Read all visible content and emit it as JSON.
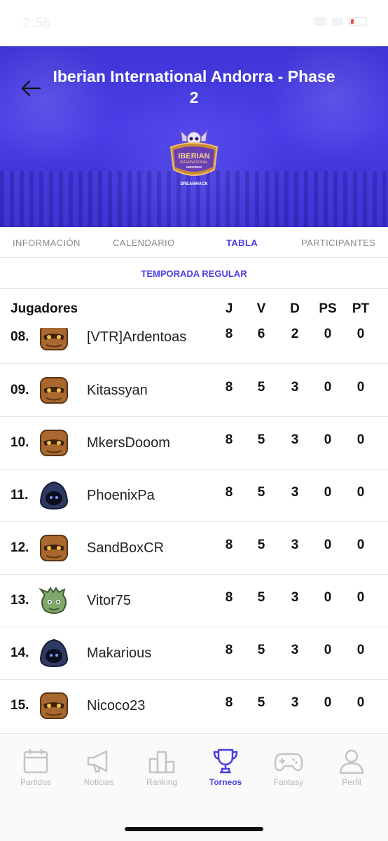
{
  "status_bar": {
    "time": "2:56"
  },
  "header": {
    "title": "Iberian International Andorra - Phase 2",
    "back_icon": "arrow-left-icon"
  },
  "logo": {
    "line1": "IBERIAN",
    "line2": "INTERNATIONAL",
    "line3": "ANDORRA",
    "line4": "DREAMHACK"
  },
  "tabs": [
    {
      "label": "INFORMACIÓN",
      "active": false
    },
    {
      "label": "CALENDARIO",
      "active": false
    },
    {
      "label": "TABLA",
      "active": true
    },
    {
      "label": "PARTICIPANTES",
      "active": false
    }
  ],
  "subtab": {
    "label": "TEMPORADA REGULAR"
  },
  "table": {
    "columns": [
      "Jugadores",
      "J",
      "V",
      "D",
      "PS",
      "PT"
    ],
    "rows": [
      {
        "pos": "08.",
        "name": "[VTR]Ardentoas",
        "avatar": "wood-mask-avatar-icon",
        "j": "8",
        "v": "6",
        "d": "2",
        "ps": "0",
        "pt": "0"
      },
      {
        "pos": "09.",
        "name": "Kitassyan",
        "avatar": "wood-mask-avatar-icon",
        "j": "8",
        "v": "5",
        "d": "3",
        "ps": "0",
        "pt": "0"
      },
      {
        "pos": "10.",
        "name": "MkersDooom",
        "avatar": "wood-mask-avatar-icon",
        "j": "8",
        "v": "5",
        "d": "3",
        "ps": "0",
        "pt": "0"
      },
      {
        "pos": "11.",
        "name": "PhoenixPa",
        "avatar": "hooded-avatar-icon",
        "j": "8",
        "v": "5",
        "d": "3",
        "ps": "0",
        "pt": "0"
      },
      {
        "pos": "12.",
        "name": "SandBoxCR",
        "avatar": "wood-mask-avatar-icon",
        "j": "8",
        "v": "5",
        "d": "3",
        "ps": "0",
        "pt": "0"
      },
      {
        "pos": "13.",
        "name": "Vitor75",
        "avatar": "goblin-avatar-icon",
        "j": "8",
        "v": "5",
        "d": "3",
        "ps": "0",
        "pt": "0"
      },
      {
        "pos": "14.",
        "name": "Makarious",
        "avatar": "hooded-avatar-icon",
        "j": "8",
        "v": "5",
        "d": "3",
        "ps": "0",
        "pt": "0"
      },
      {
        "pos": "15.",
        "name": "Nicoco23",
        "avatar": "wood-mask-avatar-icon",
        "j": "8",
        "v": "5",
        "d": "3",
        "ps": "0",
        "pt": "0"
      }
    ]
  },
  "bottom_nav": [
    {
      "label": "Partidos",
      "icon": "calendar-icon",
      "active": false
    },
    {
      "label": "Noticias",
      "icon": "megaphone-icon",
      "active": false
    },
    {
      "label": "Ranking",
      "icon": "podium-icon",
      "active": false
    },
    {
      "label": "Torneos",
      "icon": "trophy-icon",
      "active": true
    },
    {
      "label": "Fantasy",
      "icon": "gamepad-icon",
      "active": false
    },
    {
      "label": "Perfil",
      "icon": "user-icon",
      "active": false
    }
  ],
  "colors": {
    "accent": "#4b3fe0",
    "hero": "#4a3ee6",
    "inactive": "#b8b8b8"
  }
}
